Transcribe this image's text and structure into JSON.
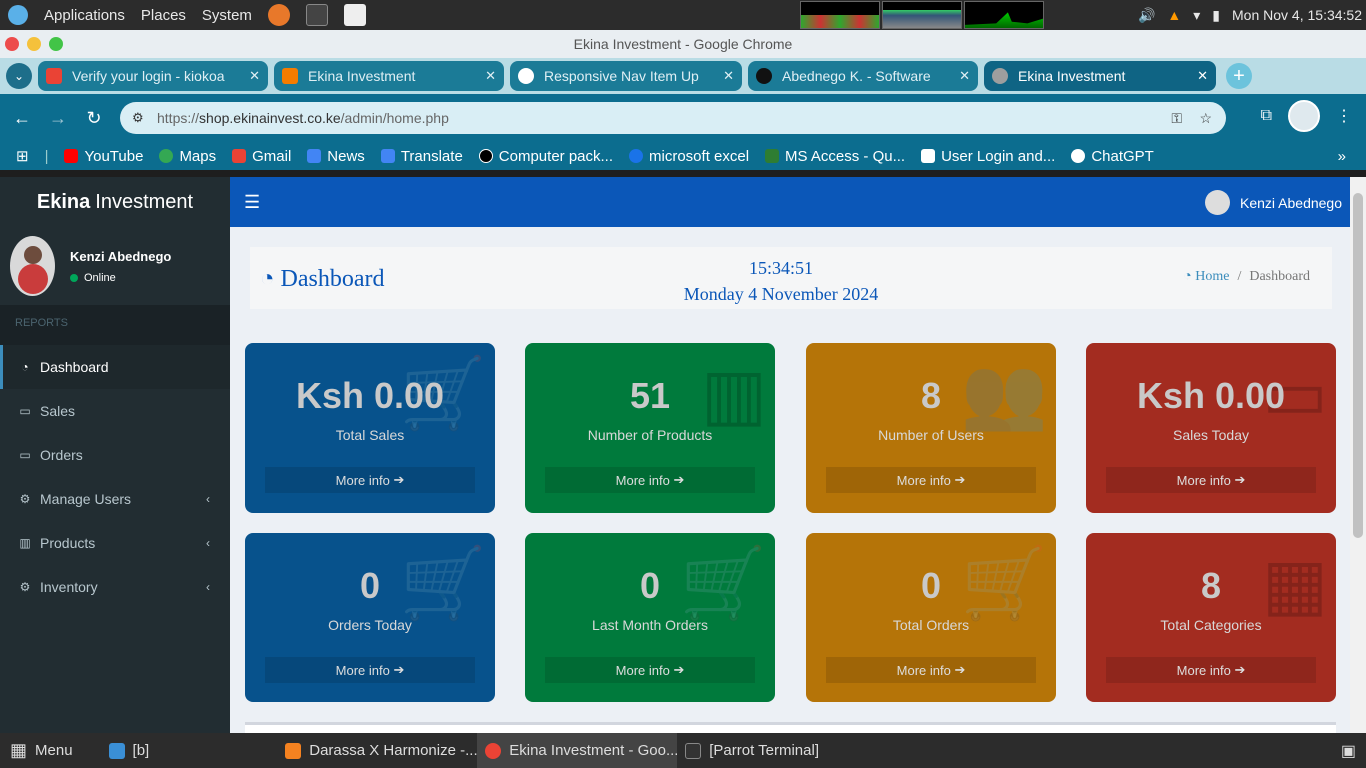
{
  "os": {
    "menu": [
      "Applications",
      "Places",
      "System"
    ],
    "clock": "Mon Nov  4, 15:34:52"
  },
  "window_title": "Ekina Investment - Google Chrome",
  "tabs": [
    {
      "label": "Verify your login - kiokoa",
      "favicon_color": "#ea4335"
    },
    {
      "label": "Ekina Investment",
      "favicon_color": "#f57c00"
    },
    {
      "label": "Responsive Nav Item Up",
      "favicon_color": "#ffffff"
    },
    {
      "label": "Abednego K. - Software",
      "favicon_color": "#111111"
    },
    {
      "label": "Ekina Investment",
      "favicon_color": "#9e9e9e"
    }
  ],
  "address": {
    "scheme": "https://",
    "host": "shop.ekinainvest.co.ke",
    "path": "/admin/home.php"
  },
  "bookmarks": [
    {
      "label": "YouTube",
      "color": "#ff0000"
    },
    {
      "label": "Maps",
      "color": "#34a853"
    },
    {
      "label": "Gmail",
      "color": "#ea4335"
    },
    {
      "label": "News",
      "color": "#4285f4"
    },
    {
      "label": "Translate",
      "color": "#4285f4"
    },
    {
      "label": "Computer pack...",
      "color": "#000000"
    },
    {
      "label": "microsoft excel",
      "color": "#1a73e8"
    },
    {
      "label": "MS Access - Qu...",
      "color": "#2e7d32"
    },
    {
      "label": "User Login and...",
      "color": "#ffffff"
    },
    {
      "label": "ChatGPT",
      "color": "#ffffff"
    }
  ],
  "app": {
    "brand_bold": "Ekina",
    "brand_rest": "Investment",
    "user_name": "Kenzi Abednego",
    "user_status": "Online",
    "section_header": "REPORTS",
    "nav": [
      {
        "label": "Dashboard",
        "icon": "dashboard-icon",
        "active": true
      },
      {
        "label": "Sales",
        "icon": "money-icon"
      },
      {
        "label": "Orders",
        "icon": "money-icon"
      },
      {
        "label": "Manage Users",
        "icon": "gears-icon",
        "expandable": true
      },
      {
        "label": "Products",
        "icon": "barcode-icon",
        "expandable": true
      },
      {
        "label": "Inventory",
        "icon": "gears-icon",
        "expandable": true
      }
    ],
    "top_user": "Kenzi Abednego",
    "page_title": "Dashboard",
    "time": "15:34:51",
    "date": "Monday 4 November 2024",
    "breadcrumb": {
      "home": "Home",
      "current": "Dashboard"
    }
  },
  "stats": [
    {
      "value": "Ksh 0.00",
      "label": "Total Sales",
      "color": "blue",
      "icon": "cart-icon"
    },
    {
      "value": "51",
      "label": "Number of Products",
      "color": "green",
      "icon": "barcode-icon"
    },
    {
      "value": "8",
      "label": "Number of Users",
      "color": "orange",
      "icon": "users-icon"
    },
    {
      "value": "Ksh 0.00",
      "label": "Sales Today",
      "color": "red",
      "icon": "money-icon"
    },
    {
      "value": "0",
      "label": "Orders Today",
      "color": "blue",
      "icon": "cart-icon"
    },
    {
      "value": "0",
      "label": "Last Month Orders",
      "color": "green",
      "icon": "cart-icon"
    },
    {
      "value": "0",
      "label": "Total Orders",
      "color": "orange",
      "icon": "cart-icon"
    },
    {
      "value": "8",
      "label": "Total Categories",
      "color": "red",
      "icon": "building-icon"
    }
  ],
  "more_info": "More info",
  "taskbar": [
    {
      "label": "Menu"
    },
    {
      "label": "[b]"
    },
    {
      "label": "Darassa X Harmonize -..."
    },
    {
      "label": "Ekina Investment - Goo..."
    },
    {
      "label": "[Parrot Terminal]"
    }
  ]
}
